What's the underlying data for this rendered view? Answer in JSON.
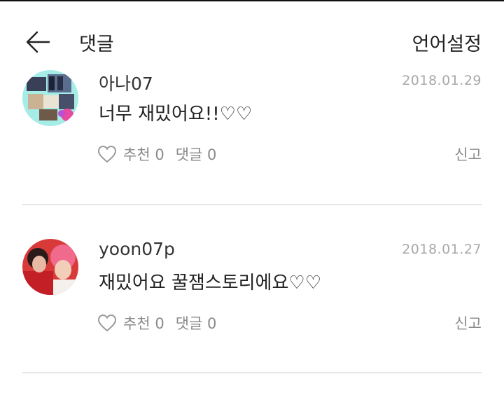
{
  "header": {
    "title": "댓글",
    "language_label": "언어설정",
    "back_icon": "arrow-left-icon"
  },
  "comments": [
    {
      "username": "아나07",
      "date": "2018.01.29",
      "content": "너무 재밌어요!!♡♡",
      "like_label": "추천 0",
      "reply_label": "댓글 0",
      "report_label": "신고",
      "like_icon": "heart-outline-icon"
    },
    {
      "username": "yoon07p",
      "date": "2018.01.27",
      "content": "재밌어요 꿀잼스토리에요♡♡",
      "like_label": "추천 0",
      "reply_label": "댓글 0",
      "report_label": "신고",
      "like_icon": "heart-outline-icon"
    }
  ],
  "colors": {
    "text": "#222222",
    "muted": "#8a8a8a",
    "date": "#a8a8a8",
    "divider": "#e6e6e6"
  }
}
